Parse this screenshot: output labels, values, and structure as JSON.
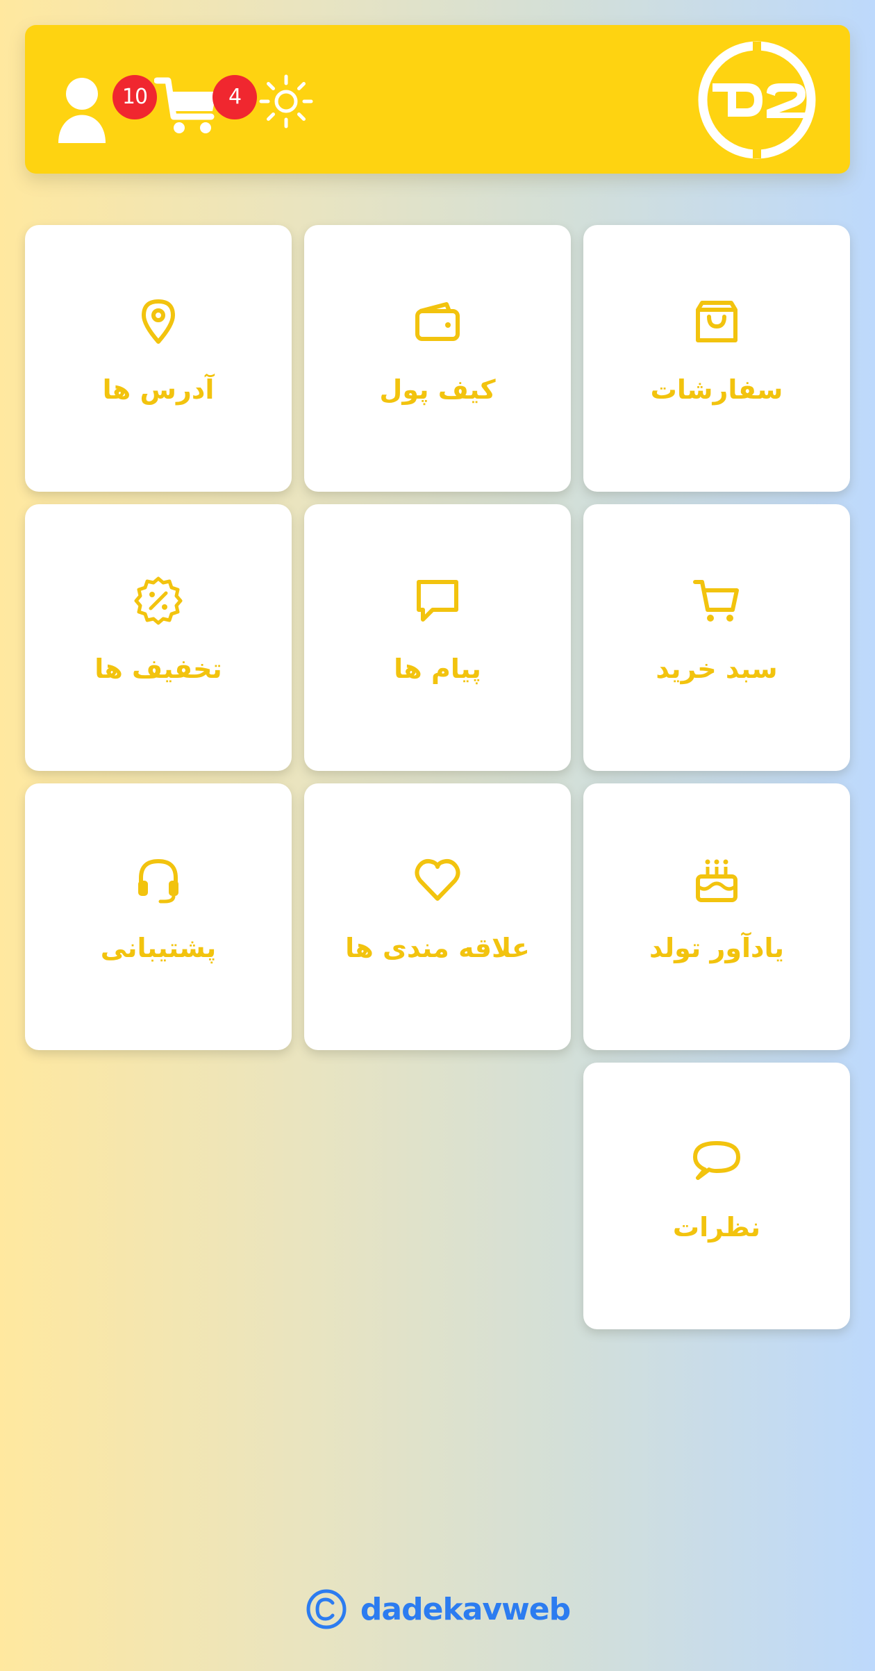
{
  "header": {
    "brand_logo": "D2",
    "profile_badge": "10",
    "cart_badge": "4",
    "icons": {
      "profile": "user-icon",
      "cart": "cart-icon",
      "theme": "sun-icon"
    },
    "colors": {
      "header_bg": "#fed311",
      "badge_bg": "#f0272f",
      "icon": "#ffffff"
    }
  },
  "menu": {
    "accent_color": "#f2c30e",
    "items": [
      {
        "label": "سفارشات",
        "icon": "shopping-bag-icon"
      },
      {
        "label": "کیف پول",
        "icon": "wallet-icon"
      },
      {
        "label": "آدرس ها",
        "icon": "location-pin-icon"
      },
      {
        "label": "سبد خرید",
        "icon": "cart-icon"
      },
      {
        "label": "پیام ها",
        "icon": "message-icon"
      },
      {
        "label": "تخفیف ها",
        "icon": "discount-icon"
      },
      {
        "label": "یادآور تولد",
        "icon": "birthday-cake-icon"
      },
      {
        "label": "علاقه مندی ها",
        "icon": "heart-icon"
      },
      {
        "label": "پشتیبانی",
        "icon": "headset-icon"
      },
      {
        "label": "نظرات",
        "icon": "comment-icon"
      }
    ]
  },
  "footer": {
    "brand": "dadekavweb",
    "icon": "copyright-icon",
    "color": "#2c7cf0"
  }
}
